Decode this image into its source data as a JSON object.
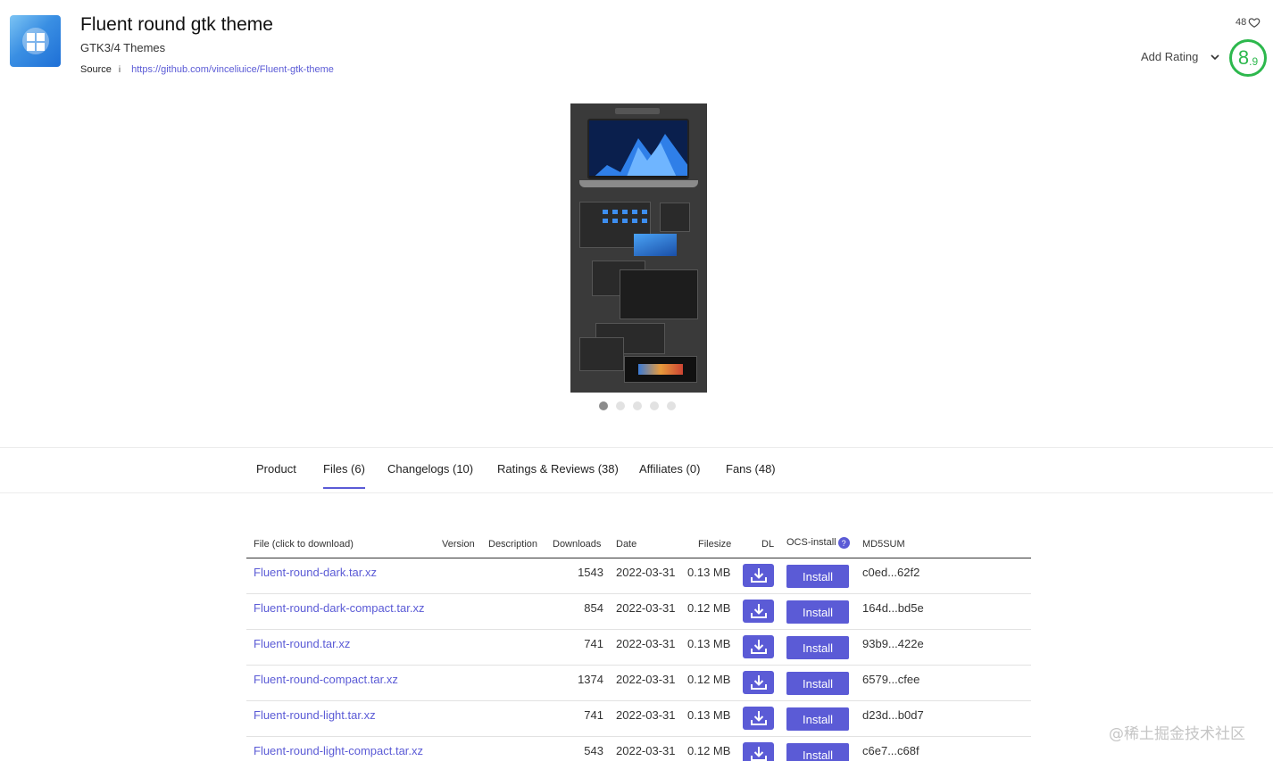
{
  "header": {
    "title": "Fluent round gtk theme",
    "subtitle": "GTK3/4 Themes",
    "source_label": "Source",
    "info_glyph": "i",
    "source_url": "https://github.com/vinceliuice/Fluent-gtk-theme",
    "likes": "48",
    "add_rating_label": "Add Rating",
    "score_major": "8",
    "score_minor": ".9",
    "score_color": "#2db84d",
    "logo_icon": "windows-grid-icon"
  },
  "carousel": {
    "slide_count": 5,
    "active_index": 0
  },
  "tabs": [
    {
      "label": "Product",
      "active": false
    },
    {
      "label": "Files (6)",
      "active": true
    },
    {
      "label": "Changelogs (10)",
      "active": false
    },
    {
      "label": "Ratings & Reviews (38)",
      "active": false
    },
    {
      "label": "Affiliates (0)",
      "active": false
    },
    {
      "label": "Fans (48)",
      "active": false
    }
  ],
  "files": {
    "columns": {
      "file": "File (click to download)",
      "version": "Version",
      "description": "Description",
      "downloads": "Downloads",
      "date": "Date",
      "filesize": "Filesize",
      "dl": "DL",
      "ocs": "OCS-install",
      "ocs_help": "?",
      "md5": "MD5SUM"
    },
    "install_label": "Install",
    "rows": [
      {
        "name": "Fluent-round-dark.tar.xz",
        "downloads": "1543",
        "date": "2022-03-31",
        "size": "0.13 MB",
        "md5": "c0ed...62f2"
      },
      {
        "name": "Fluent-round-dark-compact.tar.xz",
        "downloads": "854",
        "date": "2022-03-31",
        "size": "0.12 MB",
        "md5": "164d...bd5e"
      },
      {
        "name": "Fluent-round.tar.xz",
        "downloads": "741",
        "date": "2022-03-31",
        "size": "0.13 MB",
        "md5": "93b9...422e"
      },
      {
        "name": "Fluent-round-compact.tar.xz",
        "downloads": "1374",
        "date": "2022-03-31",
        "size": "0.12 MB",
        "md5": "6579...cfee"
      },
      {
        "name": "Fluent-round-light.tar.xz",
        "downloads": "741",
        "date": "2022-03-31",
        "size": "0.13 MB",
        "md5": "d23d...b0d7"
      },
      {
        "name": "Fluent-round-light-compact.tar.xz",
        "downloads": "543",
        "date": "2022-03-31",
        "size": "0.12 MB",
        "md5": "c6e7...c68f"
      }
    ]
  },
  "watermark": "@稀土掘金技术社区",
  "accent_color": "#5b5bd6"
}
